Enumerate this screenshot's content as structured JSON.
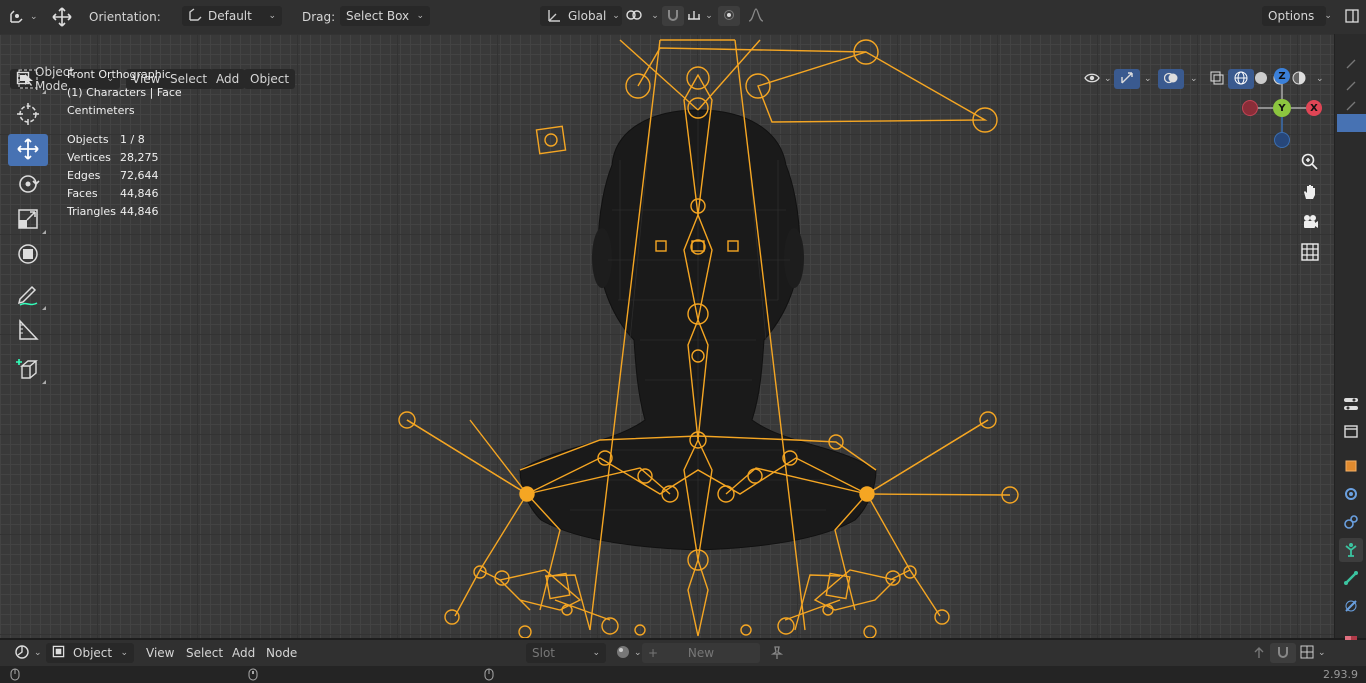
{
  "header": {
    "orientation_label": "Orientation:",
    "orientation_value": "Default",
    "drag_label": "Drag:",
    "drag_value": "Select Box",
    "transform_space": "Global",
    "options_label": "Options"
  },
  "viewport_header": {
    "mode": "Object Mode",
    "menu": [
      "View",
      "Select",
      "Add",
      "Object"
    ]
  },
  "viewport_info": {
    "view_name": "Front Orthographic",
    "collection": "(1) Characters | Face",
    "units": "Centimeters",
    "stats": [
      {
        "label": "Objects",
        "value": "1 / 8"
      },
      {
        "label": "Vertices",
        "value": "28,275"
      },
      {
        "label": "Edges",
        "value": "72,644"
      },
      {
        "label": "Faces",
        "value": "44,846"
      },
      {
        "label": "Triangles",
        "value": "44,846"
      }
    ]
  },
  "gizmo": {
    "z": "Z",
    "y": "Y",
    "x": "X"
  },
  "bottom_header": {
    "editor_type": "Object",
    "menu": [
      "View",
      "Select",
      "Add",
      "Node"
    ],
    "slot": "Slot",
    "new_button": "New"
  },
  "status": {
    "version": "2.93.9"
  },
  "colors": {
    "accent": "#4772b3",
    "armature": "#f5a623",
    "background": "#393939"
  }
}
